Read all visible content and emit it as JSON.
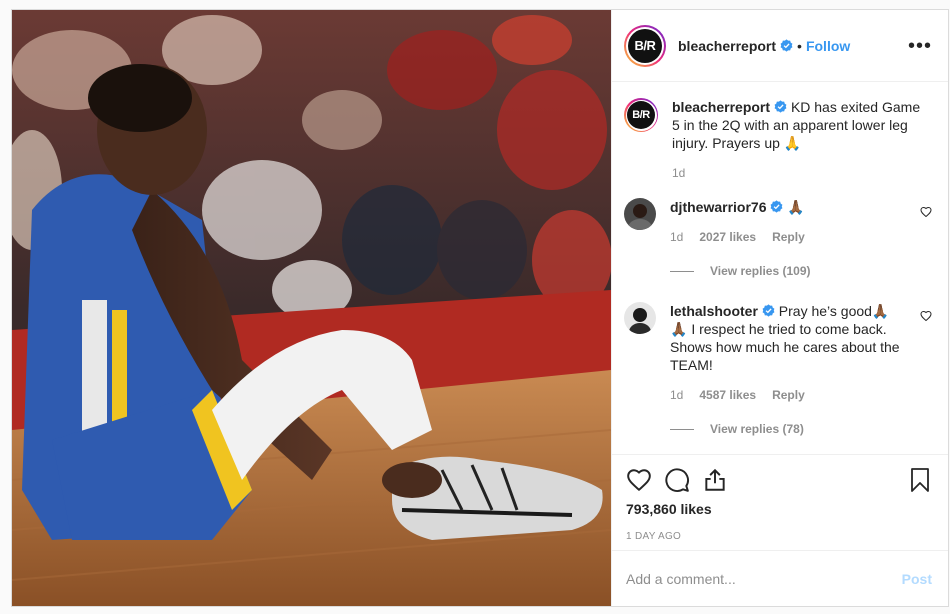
{
  "header": {
    "username": "bleacherreport",
    "avatar_text": "B/R",
    "separator": "•",
    "follow_label": "Follow",
    "more_label": "•••"
  },
  "caption": {
    "username": "bleacherreport",
    "text": "KD has exited Game 5 in the 2Q with an apparent lower leg injury. Prayers up 🙏",
    "time": "1d"
  },
  "comments": [
    {
      "username": "djthewarrior76",
      "text": "🙏🏾",
      "time": "1d",
      "likes": "2027 likes",
      "reply_label": "Reply",
      "view_replies": "View replies (109)"
    },
    {
      "username": "lethalshooter",
      "text": "Pray he’s good🙏🏾🙏🏾 I respect he tried to come back. Shows how much he cares about the TEAM!",
      "time": "1d",
      "likes": "4587 likes",
      "reply_label": "Reply",
      "view_replies": "View replies (78)"
    }
  ],
  "stats": {
    "likes": "793,860 likes",
    "time_ago": "1 DAY AGO"
  },
  "add_comment": {
    "placeholder": "Add a comment...",
    "post_label": "Post"
  },
  "colors": {
    "accent": "#3897f0",
    "post_disabled": "#b3dbff",
    "muted": "#8e8e8e",
    "verified": "#3897f0"
  },
  "icons": [
    "verified-icon",
    "heart-icon",
    "comment-icon",
    "share-icon",
    "bookmark-icon",
    "more-icon"
  ]
}
